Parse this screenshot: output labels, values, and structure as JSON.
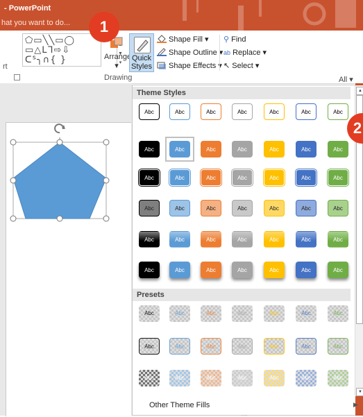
{
  "app": {
    "title": "- PowerPoint",
    "tell_me": "hat you want to do..."
  },
  "colors": {
    "brand": "#c9522e",
    "accent_blue": "#5b9bd5",
    "callout": "#e23d22"
  },
  "ribbon": {
    "left_cut_label": "rt",
    "arrange_label": "Arrange",
    "quick_styles_label_1": "Quick",
    "quick_styles_label_2": "Styles",
    "shape_fill": "Shape Fill",
    "shape_outline": "Shape Outline",
    "shape_effects": "Shape Effects",
    "find": "Find",
    "replace": "Replace",
    "select": "Select",
    "group_label": "Drawing",
    "all_filter": "All"
  },
  "gallery": {
    "theme_styles_title": "Theme Styles",
    "presets_title": "Presets",
    "tile_text": "Abc",
    "other_fills": "Other Theme Fills",
    "theme_colors": [
      "#000000",
      "#5b9bd5",
      "#ed7d31",
      "#a5a5a5",
      "#ffc000",
      "#4472c4",
      "#70ad47"
    ],
    "light_colors": [
      "#7f7f7f",
      "#9dc3e6",
      "#f4b183",
      "#c9c9c9",
      "#ffd966",
      "#8faadc",
      "#a9d18e"
    ],
    "selected": {
      "row": 1,
      "col": 1
    }
  },
  "callouts": [
    "1",
    "2"
  ]
}
